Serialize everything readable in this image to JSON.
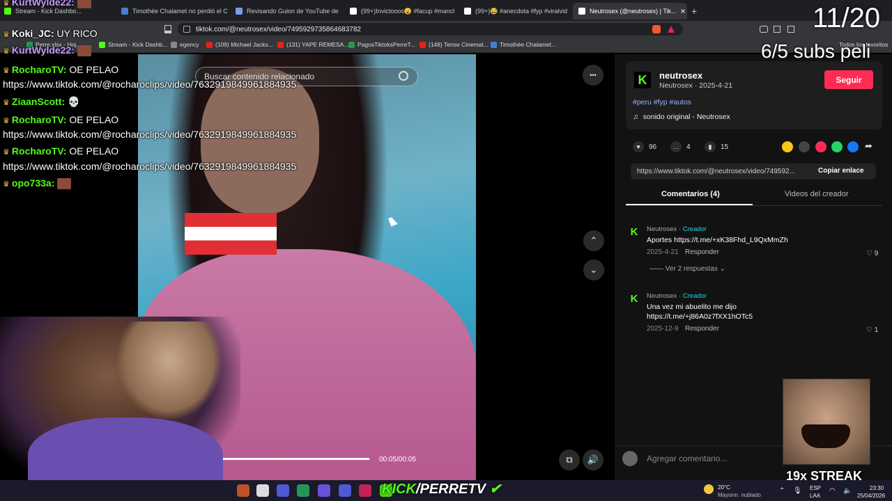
{
  "browser": {
    "tabs": [
      {
        "label": "Stream - Kick Dashbo...",
        "color": "#53fc18"
      },
      {
        "label": "Timothée Chalamet no perdió el Osc...",
        "color": "#4a7bd8"
      },
      {
        "label": "Revisando Guion de YouTube de Mar...",
        "color": "#7a9cf0"
      },
      {
        "label": "(99+)Invictooos😮 #facup #manches...",
        "color": "#ffffff"
      },
      {
        "label": "(99+)😂 #anecdota #fyp #viralvideo...",
        "color": "#ffffff"
      },
      {
        "label": "Neutrosex (@neutrosex) | Tik...",
        "color": "#ffffff"
      }
    ],
    "new_tab_symbol": "+",
    "close_tab_symbol": "×",
    "url": "tiktok.com/@neutrosex/video/7495929735864683782",
    "bookmarks": [
      {
        "label": "Perre.xlsx - Hoj...",
        "color": "#1e9c4f"
      },
      {
        "label": "Stream - Kick Dashb...",
        "color": "#53fc18"
      },
      {
        "label": "egency",
        "color": "#888888"
      },
      {
        "label": "(109) Michael Jacks...",
        "color": "#e62117"
      },
      {
        "label": "(131) YAPE REMESA...",
        "color": "#e62117"
      },
      {
        "label": "PagosTiktoksPerreT...",
        "color": "#1e9c4f"
      },
      {
        "label": "(148) Tense Cinemat...",
        "color": "#e62117"
      },
      {
        "label": "Timothée Chalamet...",
        "color": "#4a7bd8"
      }
    ],
    "all_bookmarks": "Todos los favoritos"
  },
  "video": {
    "search_placeholder": "Buscar contenido relacionado",
    "time": "00:05/00:05",
    "progress": 1.0,
    "more_symbol": "•••",
    "up_symbol": "⌃",
    "down_symbol": "⌄",
    "volume_symbol": "🔊",
    "pip_symbol": "⧉"
  },
  "author": {
    "avatar_letter": "K",
    "name": "neutrosex",
    "sub": "Neutrosex · 2025-4-21",
    "follow": "Seguir",
    "hashtags": "#peru #fyp #autos",
    "sound": "sonido original - Neutrosex",
    "note_symbol": "♫"
  },
  "stats": {
    "likes": "96",
    "comments": "4",
    "saves": "15"
  },
  "share_colors": [
    "#f5c518",
    "#444444",
    "#fe2c55",
    "#25d366",
    "#1877f2"
  ],
  "link": {
    "url": "https://www.tiktok.com/@neutrosex/video/749592...",
    "copy": "Copiar enlace"
  },
  "tabs": {
    "comments": "Comentarios (4)",
    "creator_videos": "Videos del creador"
  },
  "comments": [
    {
      "author": "Neutrosex",
      "badge": "· Creador",
      "text": "Aportes https://t.me/+xK38Fhd_L9QxMmZh",
      "date": "2025-4-21",
      "reply": "Responder",
      "likes": "9",
      "replies": "Ver 2 respuestas"
    },
    {
      "author": "Neutrosex",
      "badge": "· Creador",
      "text": "Una vez mi abuelito me dijo https://t.me/+j86A0z7fXX1hOTc5",
      "date": "2025-12-9",
      "reply": "Responder",
      "likes": "1"
    }
  ],
  "comment_input": {
    "placeholder": "Agregar comentario..."
  },
  "chat": [
    {
      "user": "KurtWylde22:",
      "text": "",
      "color": "#c79bff",
      "emote": true
    },
    {
      "user": "Koki_JC:",
      "text": " UY RICO",
      "color": "#ffffff",
      "emote": false
    },
    {
      "user": "KurtWylde22:",
      "text": "",
      "color": "#c79bff",
      "emote": true
    },
    {
      "user": "RocharoTV:",
      "text": " OE PELAO",
      "color": "#53fc18",
      "emote": false
    },
    {
      "user": "",
      "text": "https://www.tiktok.com/@rocharoclips/video/7632919849961884935",
      "color": "#ffffff",
      "emote": false
    },
    {
      "user": "ZiaanScott:",
      "text": " 💀",
      "color": "#53fc18",
      "emote": false
    },
    {
      "user": "RocharoTV:",
      "text": " OE PELAO",
      "color": "#53fc18",
      "emote": false
    },
    {
      "user": "",
      "text": "https://www.tiktok.com/@rocharoclips/video/7632919849961884935",
      "color": "#ffffff",
      "emote": false
    },
    {
      "user": "RocharoTV:",
      "text": " OE PELAO",
      "color": "#53fc18",
      "emote": false
    },
    {
      "user": "",
      "text": "https://www.tiktok.com/@rocharoclips/video/7632919849961884935",
      "color": "#ffffff",
      "emote": false
    },
    {
      "user": "opo733a:",
      "text": "",
      "color": "#53fc18",
      "emote": true
    }
  ],
  "overlay": {
    "counter": "11/20",
    "subs": "6/5 subs peli",
    "streak": "19x STREAK",
    "kick_prefix": "KICK",
    "kick_name": "/PERRETV"
  },
  "taskbar": {
    "weather_temp": "20°C",
    "weather_desc": "Mayorm. nublado",
    "lang": "ESP",
    "lang_sub": "LAA",
    "time": "23:30",
    "date": "25/04/2026",
    "icon_colors": [
      "#e05a2b",
      "#ffffff",
      "#5865f2",
      "#27ae60",
      "#7a5af8",
      "#5865f2",
      "#e0245e",
      "#53fc18"
    ]
  }
}
